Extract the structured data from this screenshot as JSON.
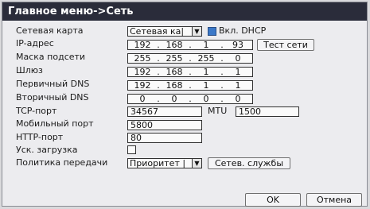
{
  "title": "Главное меню->Сеть",
  "labels": {
    "card": "Сетевая карта",
    "ip": "IP-адрес",
    "mask": "Маска подсети",
    "gateway": "Шлюз",
    "dns1": "Первичный DNS",
    "dns2": "Вторичный DNS",
    "tcp": "TCP-порт",
    "mobile": "Мобильный порт",
    "http": "HTTP-порт",
    "fast": "Уск. загрузка",
    "policy": "Политика передачи"
  },
  "card_value": "Сетевая ка|",
  "dhcp_label": "Вкл. DHCP",
  "dhcp_checked": true,
  "ip": [
    "192",
    "168",
    "1",
    "93"
  ],
  "mask": [
    "255",
    "255",
    "255",
    "0"
  ],
  "gateway": [
    "192",
    "168",
    "1",
    "1"
  ],
  "dns1": [
    "192",
    "168",
    "1",
    "1"
  ],
  "dns2": [
    "0",
    "0",
    "0",
    "0"
  ],
  "tcp_port": "34567",
  "mtu_label": "MTU",
  "mtu_value": "1500",
  "mobile_port": "5800",
  "http_port": "80",
  "fast_checked": false,
  "policy_value": "Приоритет |",
  "buttons": {
    "test": "Тест сети",
    "services": "Сетев. службы",
    "ok": "OK",
    "cancel": "Отмена"
  }
}
